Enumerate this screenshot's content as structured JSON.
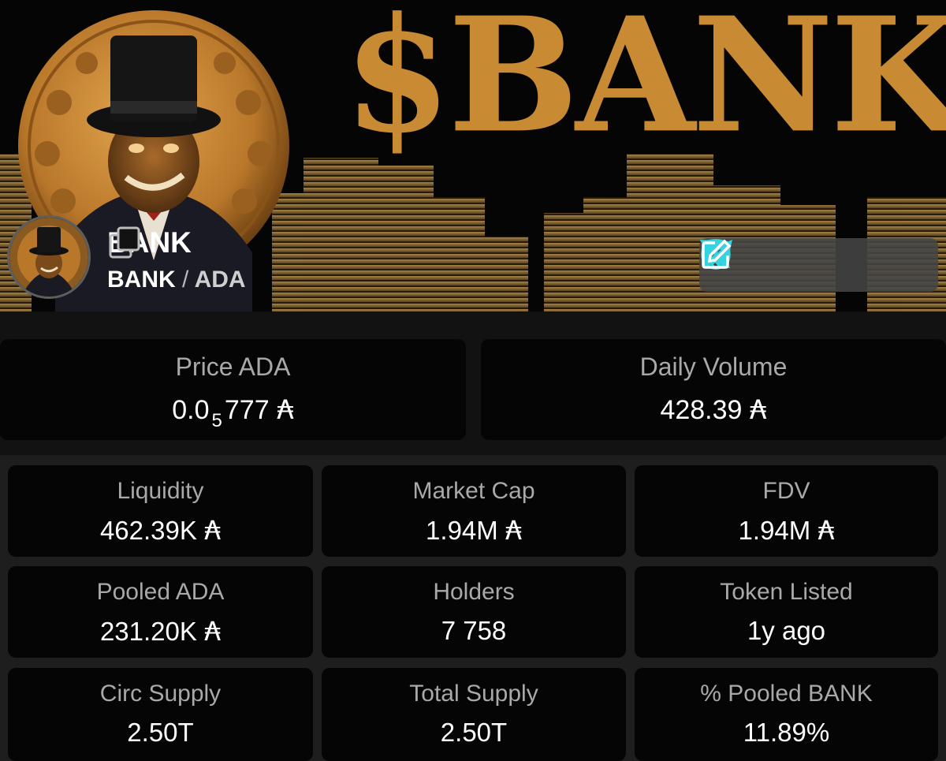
{
  "banner": {
    "title": "$BANK",
    "token_name": "BANK",
    "pair_base": "BANK",
    "pair_separator": "/",
    "pair_quote": "ADA",
    "accent_color": "#c98a34",
    "social_icons": [
      "globe-icon",
      "x-icon",
      "discord-icon",
      "telegram-icon",
      "edit-icon"
    ],
    "copy_icon": "copy-icon"
  },
  "price": {
    "label": "Price ADA",
    "prefix": "0.0",
    "zeros_subscript": "5",
    "digits": "777",
    "symbol": "₳"
  },
  "daily_volume": {
    "label": "Daily Volume",
    "value": "428.39",
    "symbol": "₳"
  },
  "stats": [
    {
      "label": "Liquidity",
      "value": "462.39K",
      "symbol": "₳"
    },
    {
      "label": "Market Cap",
      "value": "1.94M",
      "symbol": "₳"
    },
    {
      "label": "FDV",
      "value": "1.94M",
      "symbol": "₳"
    },
    {
      "label": "Pooled ADA",
      "value": "231.20K",
      "symbol": "₳"
    },
    {
      "label": "Holders",
      "value": "7 758",
      "symbol": ""
    },
    {
      "label": "Token Listed",
      "value": "1y ago",
      "symbol": ""
    },
    {
      "label": "Circ Supply",
      "value": "2.50T",
      "symbol": ""
    },
    {
      "label": "Total Supply",
      "value": "2.50T",
      "symbol": ""
    },
    {
      "label": "% Pooled BANK",
      "value": "11.89%",
      "symbol": ""
    }
  ]
}
